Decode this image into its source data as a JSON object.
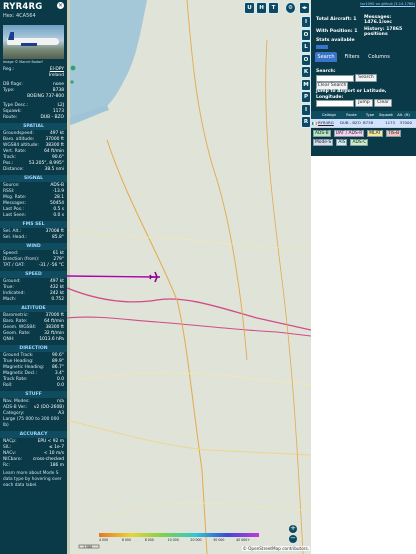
{
  "aircraft": {
    "callsign": "RYR4RG",
    "hex_label": "Hex:",
    "hex": "4CA564",
    "close_glyph": "×",
    "photo_credit": "Image © Marcel Bodarf",
    "reg_label": "Reg.:",
    "reg": "EI-DPY",
    "country": "Ireland",
    "db_flags_label": "DB flags:",
    "db_flags": "none",
    "type_label": "Type:",
    "type": "B738",
    "type_full": "BOEING 737-800",
    "type_desc_label": "Type Desc.:",
    "type_desc": "L2J",
    "squawk_label": "Squawk:",
    "squawk": "1173",
    "route_label": "Route:",
    "route": "DUB - BZO"
  },
  "sections": {
    "spatial": "SPATIAL",
    "signal": "SIGNAL",
    "fms": "FMS SEL",
    "wind": "WIND",
    "speed": "SPEED",
    "altitude": "ALTITUDE",
    "direction": "DIRECTION",
    "stuff": "STUFF",
    "accuracy": "ACCURACY"
  },
  "spatial": [
    {
      "label": "Groundspeed:",
      "value": "497 kt"
    },
    {
      "label": "Baro. altitude:",
      "value": "37000 ft"
    },
    {
      "label": "WGS84 altitude:",
      "value": "38300 ft"
    },
    {
      "label": "Vert. Rate:",
      "value": "64 ft/min"
    },
    {
      "label": "Track:",
      "value": "90.6°"
    },
    {
      "label": "Pos.:",
      "value": "53.205°, 8.995°"
    },
    {
      "label": "Distance:",
      "value": "38.5 nmi"
    }
  ],
  "signal": [
    {
      "label": "Source:",
      "value": "ADS-B"
    },
    {
      "label": "RSSI:",
      "value": "-13.9"
    },
    {
      "label": "Msg. Rate:",
      "value": "28.1"
    },
    {
      "label": "Messages:",
      "value": "50454"
    },
    {
      "label": "Last Pos.:",
      "value": "0.5 s"
    },
    {
      "label": "Last Seen:",
      "value": "0.0 s"
    }
  ],
  "fms": [
    {
      "label": "Sel. Alt.:",
      "value": "37008 ft"
    },
    {
      "label": "Sel. Head.:",
      "value": "85.8°"
    }
  ],
  "wind": [
    {
      "label": "Speed:",
      "value": "61 kt"
    },
    {
      "label": "Direction (from):",
      "value": "279°"
    },
    {
      "label": "TAT / OAT:",
      "value": "-31 / -56 °C"
    }
  ],
  "speed": [
    {
      "label": "Ground:",
      "value": "497 kt"
    },
    {
      "label": "True:",
      "value": "432 kt"
    },
    {
      "label": "Indicated:",
      "value": "242 kt"
    },
    {
      "label": "Mach:",
      "value": "0.752"
    }
  ],
  "altitude": [
    {
      "label": "Barometric:",
      "value": "37000 ft"
    },
    {
      "label": "Baro. Rate:",
      "value": "64 ft/min"
    },
    {
      "label": "Geom. WGS84:",
      "value": "38300 ft"
    },
    {
      "label": "Geom. Rate:",
      "value": "32 ft/min"
    },
    {
      "label": "QNH:",
      "value": "1013.6 hPa"
    }
  ],
  "direction": [
    {
      "label": "Ground Track:",
      "value": "90.6°"
    },
    {
      "label": "True Heading:",
      "value": "89.9°"
    },
    {
      "label": "Magnetic Heading:",
      "value": "86.7°"
    },
    {
      "label": "Magnetic Decl.:",
      "value": "3.4°"
    },
    {
      "label": "Track Rate:",
      "value": "0.0"
    },
    {
      "label": "Roll:",
      "value": "0.0"
    }
  ],
  "stuff": [
    {
      "label": "Nav. Modes:",
      "value": "n/a"
    },
    {
      "label": "ADS-B Ver.:",
      "value": "v2 (DO-260B)"
    },
    {
      "label": "Category:",
      "value": "A3"
    }
  ],
  "category_desc": "Large (75 000 to 300 000 lb)",
  "accuracy": [
    {
      "label": "NACp:",
      "value": "EPU < 92 m"
    },
    {
      "label": "SIL:",
      "value": "≤ 1e-7"
    },
    {
      "label": "NACv:",
      "value": "< 10 m/s"
    },
    {
      "label": "NICbaro:",
      "value": "cross-checked"
    },
    {
      "label": "Rc:",
      "value": "186 m"
    }
  ],
  "learn_more": "Learn more about Mode S data type by hovering over each data label.",
  "map_buttons": [
    "U",
    "H",
    "T"
  ],
  "side_buttons": [
    "I",
    "O",
    "L",
    "O",
    "K",
    "M",
    "P",
    "I",
    "R"
  ],
  "map": {
    "scale_label": "1 NM",
    "alt_scale": [
      "4 000",
      "6 000",
      "8 000",
      "10 000",
      "20 000",
      "30 000",
      "40 000+"
    ],
    "zoom_in": "+",
    "zoom_out": "−",
    "attribution": "© OpenStreetMap contributors."
  },
  "panel": {
    "header_link": "tar1090 on github (3.14.1768)",
    "total_aircraft_label": "Total Aircraft:",
    "total_aircraft": "1",
    "messages_label": "Messages:",
    "messages_value": "1476.1/sec",
    "with_position_label": "With Position:",
    "with_position": "1",
    "history_label": "History:",
    "history_value": "17865 positions",
    "stats_label": "Stats available",
    "tabs": [
      "Search",
      "Filters",
      "Columns"
    ],
    "search_label": "Search:",
    "search_button": "Search",
    "clear_search": "Clear Search",
    "jump_label": "Jump to Airport or Latitude, Longitude:",
    "jump_button": "Jump",
    "clear_button": "Clear",
    "table_headers": [
      "Callsign",
      "Route",
      "Type",
      "Squawk",
      "Alt. (ft)"
    ],
    "table_row": {
      "callsign": "RYR4RG",
      "route": "DUB - BZO",
      "type": "B738",
      "squawk": "1173",
      "alt": "37000"
    },
    "legend": [
      "ADS-B",
      "UAT / ADS-R",
      "MLAT",
      "TIS-B",
      "Mode-S",
      "AIS",
      "ADS-C"
    ]
  },
  "colors": {
    "sidebar_bg": "#0a3a48",
    "accent": "#0c4a63",
    "track": "#b000b0",
    "selected_row": "#d0e2ff"
  }
}
